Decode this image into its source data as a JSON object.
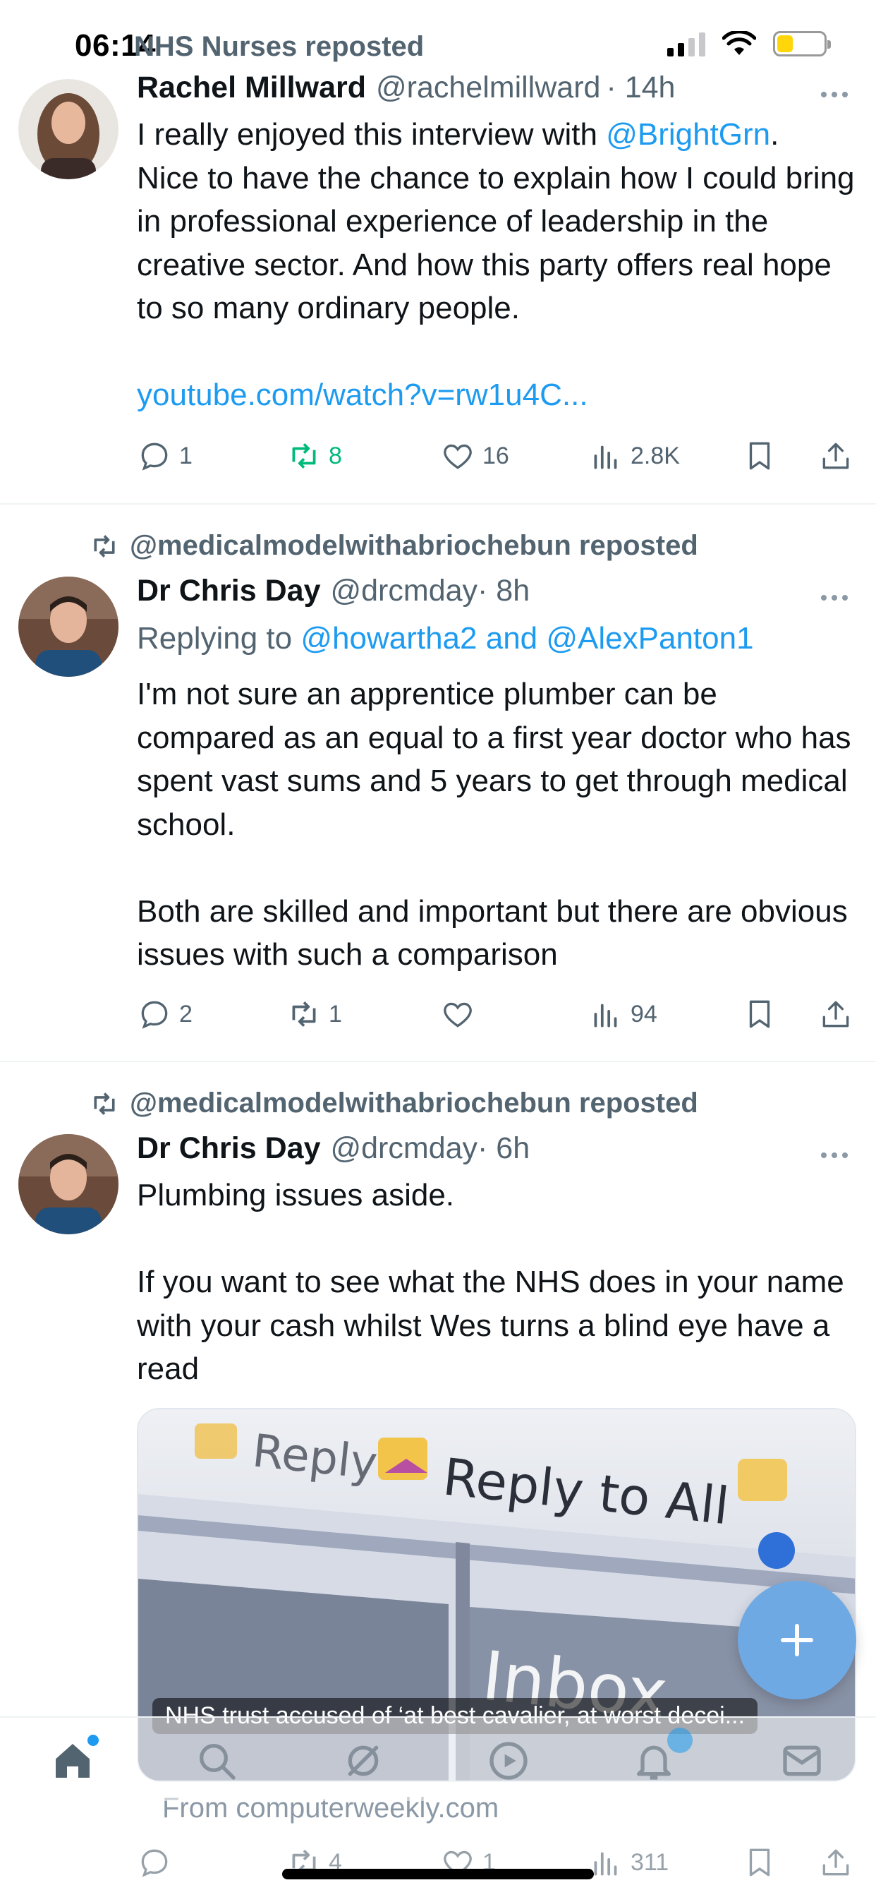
{
  "status_bar": {
    "time": "06:14"
  },
  "tweets": [
    {
      "repost_label": "NHS Nurses reposted",
      "name": "Rachel Millward",
      "handle": "@rachelmillward",
      "time": "· 14h",
      "text_prefix": "I really enjoyed this interview with ",
      "mention": "@BrightGrn",
      "text_suffix": ".\nNice to have the chance to explain how I could bring in professional experience of leadership in the creative sector. And how this party offers real hope to so many ordinary people.",
      "link": "youtube.com/watch?v=rw1u4C...",
      "stats": {
        "replies": "1",
        "reposts": "8",
        "likes": "16",
        "views": "2.8K"
      }
    },
    {
      "repost_label": "@medicalmodelwithabriochebun reposted",
      "name": "Dr Chris Day",
      "handle": "@drcmday",
      "time": "· 8h",
      "reply_prefix": "Replying to ",
      "reply_to": "@howartha2 and @AlexPanton1",
      "text": "I'm not sure an apprentice plumber can be compared as an equal to a first year doctor who has spent vast sums and 5 years to get through medical school.\n\nBoth are skilled and important but there are obvious issues with such a comparison",
      "stats": {
        "replies": "2",
        "reposts": "1",
        "likes": "",
        "views": "94"
      }
    },
    {
      "repost_label": "@medicalmodelwithabriochebun reposted",
      "name": "Dr Chris Day",
      "handle": "@drcmday",
      "time": "· 6h",
      "text": "Plumbing issues aside.\n\nIf you want to see what the NHS does in your name with your cash whilst Wes turns a blind eye have a read",
      "card_caption": "NHS trust accused of ‘at best cavalier, at worst decei...",
      "card_image_words": [
        "Reply",
        "Reply to All",
        "Inbox"
      ],
      "card_source": "From computerweekly.com",
      "stats": {
        "replies": "",
        "reposts": "4",
        "likes": "1",
        "views": "311"
      }
    }
  ],
  "colors": {
    "accent": "#1d9bf0",
    "repost_green": "#00ba7c",
    "secondary_text": "#536471"
  },
  "icons": [
    "repost-icon",
    "reply-icon",
    "like-icon",
    "views-icon",
    "bookmark-icon",
    "share-icon",
    "home-icon",
    "search-icon",
    "grok-icon",
    "video-icon",
    "bell-icon",
    "mail-icon",
    "plus-icon"
  ]
}
